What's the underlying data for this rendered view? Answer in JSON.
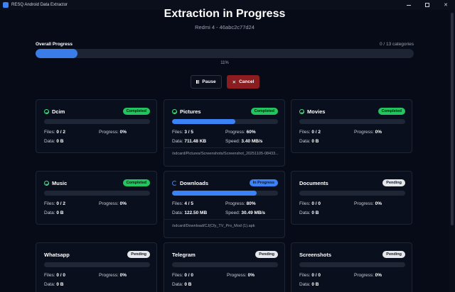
{
  "window": {
    "title": "RESQ Android Data Extractor",
    "controls": [
      "minimize",
      "maximize",
      "close"
    ]
  },
  "header": {
    "title": "Extraction in Progress",
    "subtitle": "Redmi 4 - 46abc2c77d24"
  },
  "overall": {
    "label": "Overall Progress",
    "count": "0 / 13 categories",
    "percent_text": "11%",
    "fraction": 0.11
  },
  "actions": {
    "pause_label": "Pause",
    "cancel_label": "Cancel"
  },
  "labels": {
    "files": "Files:",
    "progress": "Progress:",
    "data": "Data:",
    "speed": "Speed:"
  },
  "colors": {
    "accent": "#3b82f6",
    "completed": "#22c55e",
    "cancel": "#8b1c20",
    "background": "#070b18"
  },
  "categories": [
    {
      "name": "Dcim",
      "status": "Completed",
      "icon": "check-circle-icon",
      "files": "0 / 2",
      "progress": "0%",
      "data": "0 B",
      "fraction": 0
    },
    {
      "name": "Pictures",
      "status": "Completed",
      "icon": "check-circle-icon",
      "files": "3 / 5",
      "progress": "60%",
      "data": "711.48 KB",
      "speed": "3.40 MB/s",
      "path": "/sdcard/Pictures/Screenshots/Screenshot_20251105-08433...",
      "fraction": 0.6
    },
    {
      "name": "Movies",
      "status": "Completed",
      "icon": "check-circle-icon",
      "files": "0 / 2",
      "progress": "0%",
      "data": "0 B",
      "fraction": 0
    },
    {
      "name": "Music",
      "status": "Completed",
      "icon": "check-circle-icon",
      "files": "0 / 2",
      "progress": "0%",
      "data": "0 B",
      "fraction": 0
    },
    {
      "name": "Downloads",
      "status": "In Progress",
      "icon": "spinner-icon",
      "files": "4 / 5",
      "progress": "80%",
      "data": "122.50 MB",
      "speed": "30.49 MB/s",
      "path": "/sdcard/Download/CJ(Cfy_TV_Pro_Mod (1).apk",
      "fraction": 0.8
    },
    {
      "name": "Documents",
      "status": "Pending",
      "files": "0 / 0",
      "progress": "0%",
      "data": "0 B",
      "fraction": 0
    },
    {
      "name": "Whatsapp",
      "status": "Pending",
      "files": "0 / 0",
      "progress": "0%",
      "data": "0 B",
      "fraction": 0
    },
    {
      "name": "Telegram",
      "status": "Pending",
      "files": "0 / 0",
      "progress": "0%",
      "data": "0 B",
      "fraction": 0
    },
    {
      "name": "Screenshots",
      "status": "Pending",
      "files": "0 / 0",
      "progress": "0%",
      "data": "0 B",
      "fraction": 0
    }
  ]
}
